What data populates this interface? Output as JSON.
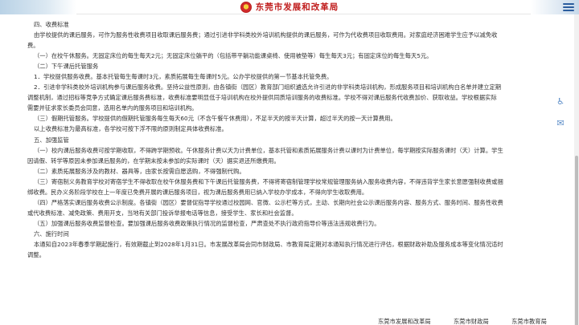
{
  "header": {
    "title": "东莞市发展和改革局",
    "top_cut_text": "...."
  },
  "content": {
    "lines": [
      "四、收费标准",
      "由学校提供的课后服务，可作为服务性收费项目收取课后服务费；通过引进非学科类校外培训机构提供的课后服务，可作为代收费项目收取费用。对家庭经济困难学生应予以减免收",
      "费。",
      "（一）在校午休服务。无固定床位的每生每天2元；无固定床位躺平的（包括带平躺功能课桌椅、使用被垫等）每生每天3元；有固定床位的每生每天5元。",
      "（二）下午课后托管服务",
      "1．学校提供服务收费。基本托管每生每课时3元，素质拓展每生每课时5元。公办学校提供的第一节基本托管免费。",
      "2．引进非学科类校外培训机构参与课后服务收费。坚持公益性原则，由各镇街（园区）教育部门组织遴选允许引进的非学科类培训机构，形成服务项目和培训机构白名单并建立定期",
      "调整机制，通过招标等竞争方式确定课后服务费标准，收费标准要明显低于培训机构在校外提供同质培训服务的收费标准。学校不得对课后服务代收费加价、获取收益。学校根据实际",
      "需要并征求家长委员会同意，选用名单内的服务项目和培训机构。",
      "（三）假期托管服务。学校提供的假期托管服务每生每天60元（不含午餐午休费用），不足半天的按半天计算，超过半天的按一天计算费用。",
      "以上收费标准为最高标准，各学校可按下浮不限的原则制定具体收费标准。",
      "五、加强监管",
      "（一）校内课后服务收费可按学期收取，不得跨学期预收。午休服务计费以天为计费单位，基本托管和素质拓展服务计费以课时为计费单位，每学期按实际服务课时（天）计算。学生",
      "因请假、转学等原因未参加课后服务的，在学期末按未参加的实际课时（天）据实退还所缴费用。",
      "（二）素质拓展服务涉及的教材、器具等，由家长按需自愿选购，不得强制代购。",
      "（三）寄宿制义务教育学校对寄宿学生不得收取在校午休服务费和下午课后托管服务费，不得将寄宿制管理学校常规管理服务纳入服务收费内容，不得违背学生家长意愿强制收费或捆",
      "绑收费。民办义务阶段学校在上一年度已免费开展的课后服务项目，视为课后服务费用已纳入学校办学成本，不得向学生收取费用。",
      "（四）严格落实课后服务收费公示制度。各镇街（园区）要督促指导学校通过校园网、官微、公示栏等方式，主动、长期向社会公示课后服务内容、服务方式、服务时间、服务性收费",
      "或代收费标准、减免政策、费用开支，当地有关部门投诉举报电话等信息，接受学生、家长和社会监督。",
      "（五）加强课后服务收费监督检查。要加强课后服务收费政策执行情况的监督检查，严肃查处不执行政府指导价等违法违规收费行为。",
      "六、施行时间",
      "本通知自2023年春季学期起施行，有效期截止到2028年1月31日。市发展改革局会同市财政局、市教育局定期对本通知执行情况进行评估，根据财政补助及服务成本等变化情况适时",
      "调整。"
    ]
  },
  "footer": {
    "items": [
      "东莞市发展和改革局",
      "东莞市财政局",
      "东莞市教育局"
    ]
  },
  "tools": {
    "accessibility_icon": "wheelchair-icon",
    "message_icon": "chat-icon"
  },
  "colors": {
    "title_red": "#c01d1d",
    "accent_blue": "#2b5d9e"
  }
}
